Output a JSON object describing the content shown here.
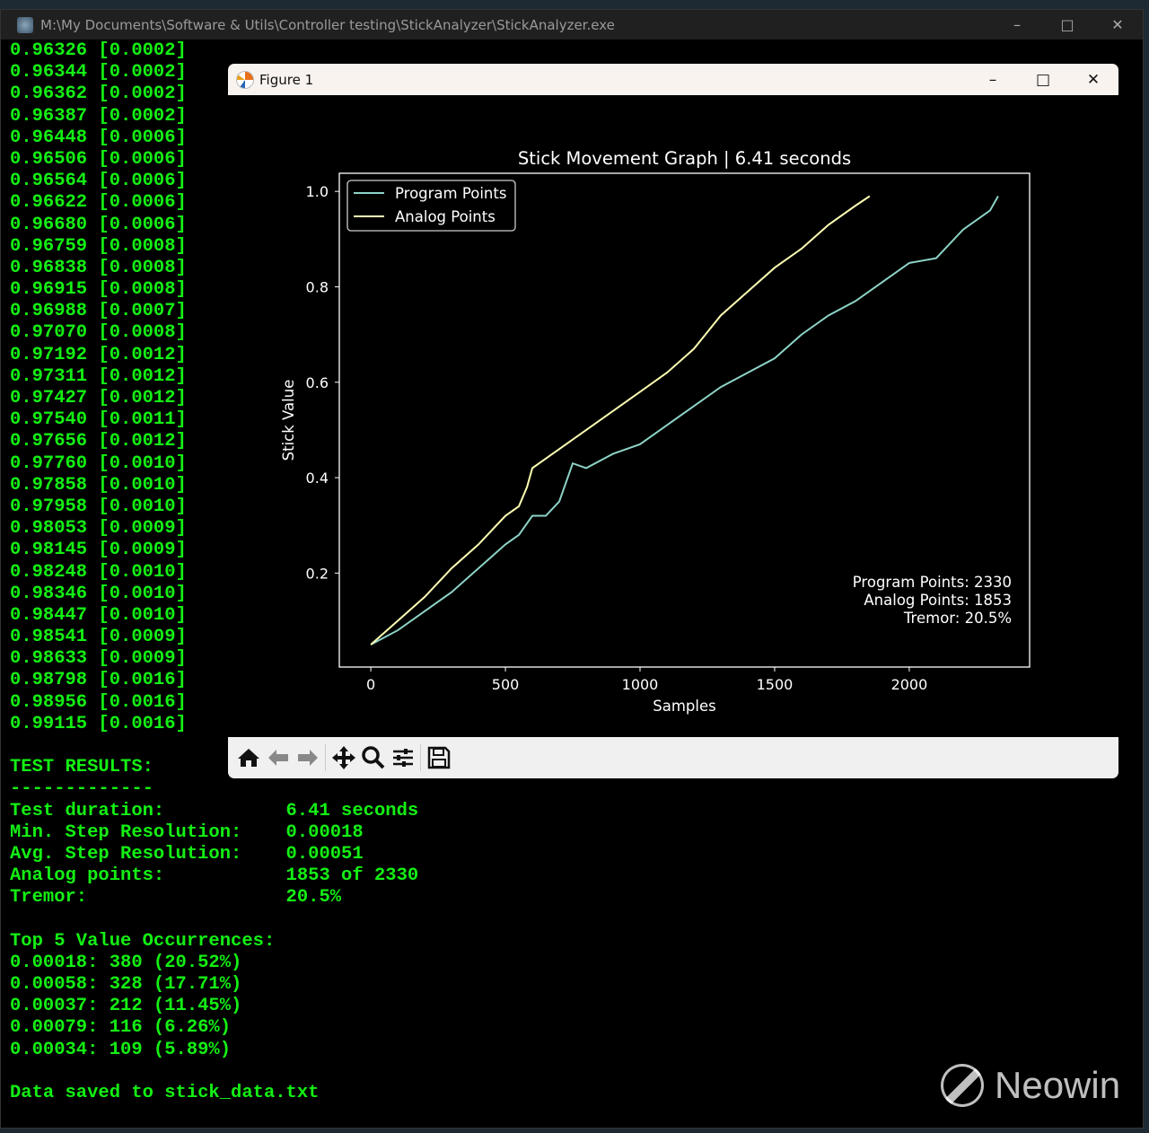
{
  "console": {
    "title": "M:\\My Documents\\Software & Utils\\Controller testing\\StickAnalyzer\\StickAnalyzer.exe",
    "lines": [
      "0.96326 [0.0002]",
      "0.96344 [0.0002]",
      "0.96362 [0.0002]",
      "0.96387 [0.0002]",
      "0.96448 [0.0006]",
      "0.96506 [0.0006]",
      "0.96564 [0.0006]",
      "0.96622 [0.0006]",
      "0.96680 [0.0006]",
      "0.96759 [0.0008]",
      "0.96838 [0.0008]",
      "0.96915 [0.0008]",
      "0.96988 [0.0007]",
      "0.97070 [0.0008]",
      "0.97192 [0.0012]",
      "0.97311 [0.0012]",
      "0.97427 [0.0012]",
      "0.97540 [0.0011]",
      "0.97656 [0.0012]",
      "0.97760 [0.0010]",
      "0.97858 [0.0010]",
      "0.97958 [0.0010]",
      "0.98053 [0.0009]",
      "0.98145 [0.0009]",
      "0.98248 [0.0010]",
      "0.98346 [0.0010]",
      "0.98447 [0.0010]",
      "0.98541 [0.0009]",
      "0.98633 [0.0009]",
      "0.98798 [0.0016]",
      "0.98956 [0.0016]",
      "0.99115 [0.0016]",
      "",
      "TEST RESULTS:",
      "-------------",
      "Test duration:           6.41 seconds",
      "Min. Step Resolution:    0.00018",
      "Avg. Step Resolution:    0.00051",
      "Analog points:           1853 of 2330",
      "Tremor:                  20.5%",
      "",
      "Top 5 Value Occurrences:",
      "0.00018: 380 (20.52%)",
      "0.00058: 328 (17.71%)",
      "0.00037: 212 (11.45%)",
      "0.00079: 116 (6.26%)",
      "0.00034: 109 (5.89%)",
      "",
      "Data saved to stick_data.txt"
    ],
    "text_color": "#14f014"
  },
  "figure": {
    "title": "Figure 1",
    "toolbar": [
      "home-icon",
      "back-icon",
      "forward-icon",
      "pan-icon",
      "zoom-icon",
      "configure-icon",
      "save-icon"
    ]
  },
  "chart_data": {
    "type": "line",
    "title": "Stick Movement Graph | 6.41 seconds",
    "xlabel": "Samples",
    "ylabel": "Stick Value",
    "xlim": [
      -117,
      2447
    ],
    "ylim": [
      0.003,
      1.038
    ],
    "xticks": [
      0,
      500,
      1000,
      1500,
      2000
    ],
    "yticks": [
      0.2,
      0.4,
      0.6,
      0.8,
      1.0
    ],
    "xtick_labels": [
      "0",
      "500",
      "1000",
      "1500",
      "2000"
    ],
    "ytick_labels": [
      "0.2",
      "0.4",
      "0.6",
      "0.8",
      "1.0"
    ],
    "legend": "top-left",
    "grid": false,
    "series": [
      {
        "name": "Program Points",
        "color": "#8dd3c7",
        "x": [
          0,
          100,
          200,
          300,
          400,
          500,
          550,
          600,
          650,
          700,
          750,
          800,
          900,
          1000,
          1100,
          1200,
          1300,
          1400,
          1500,
          1600,
          1700,
          1800,
          1900,
          2000,
          2100,
          2200,
          2300,
          2330
        ],
        "y": [
          0.05,
          0.08,
          0.12,
          0.16,
          0.21,
          0.26,
          0.28,
          0.32,
          0.32,
          0.35,
          0.43,
          0.42,
          0.45,
          0.47,
          0.51,
          0.55,
          0.59,
          0.62,
          0.65,
          0.7,
          0.74,
          0.77,
          0.81,
          0.85,
          0.86,
          0.92,
          0.96,
          0.99
        ]
      },
      {
        "name": "Analog Points",
        "color": "#feffb3",
        "x": [
          0,
          100,
          200,
          300,
          400,
          450,
          500,
          550,
          580,
          600,
          700,
          800,
          900,
          1000,
          1100,
          1200,
          1300,
          1400,
          1500,
          1600,
          1700,
          1800,
          1853
        ],
        "y": [
          0.05,
          0.1,
          0.15,
          0.21,
          0.26,
          0.29,
          0.32,
          0.34,
          0.38,
          0.42,
          0.46,
          0.5,
          0.54,
          0.58,
          0.62,
          0.67,
          0.74,
          0.79,
          0.84,
          0.88,
          0.93,
          0.97,
          0.99
        ]
      }
    ],
    "annotations": [
      "Program Points: 2330",
      "Analog Points: 1853",
      "Tremor: 20.5%"
    ]
  },
  "watermark": "Neowin"
}
